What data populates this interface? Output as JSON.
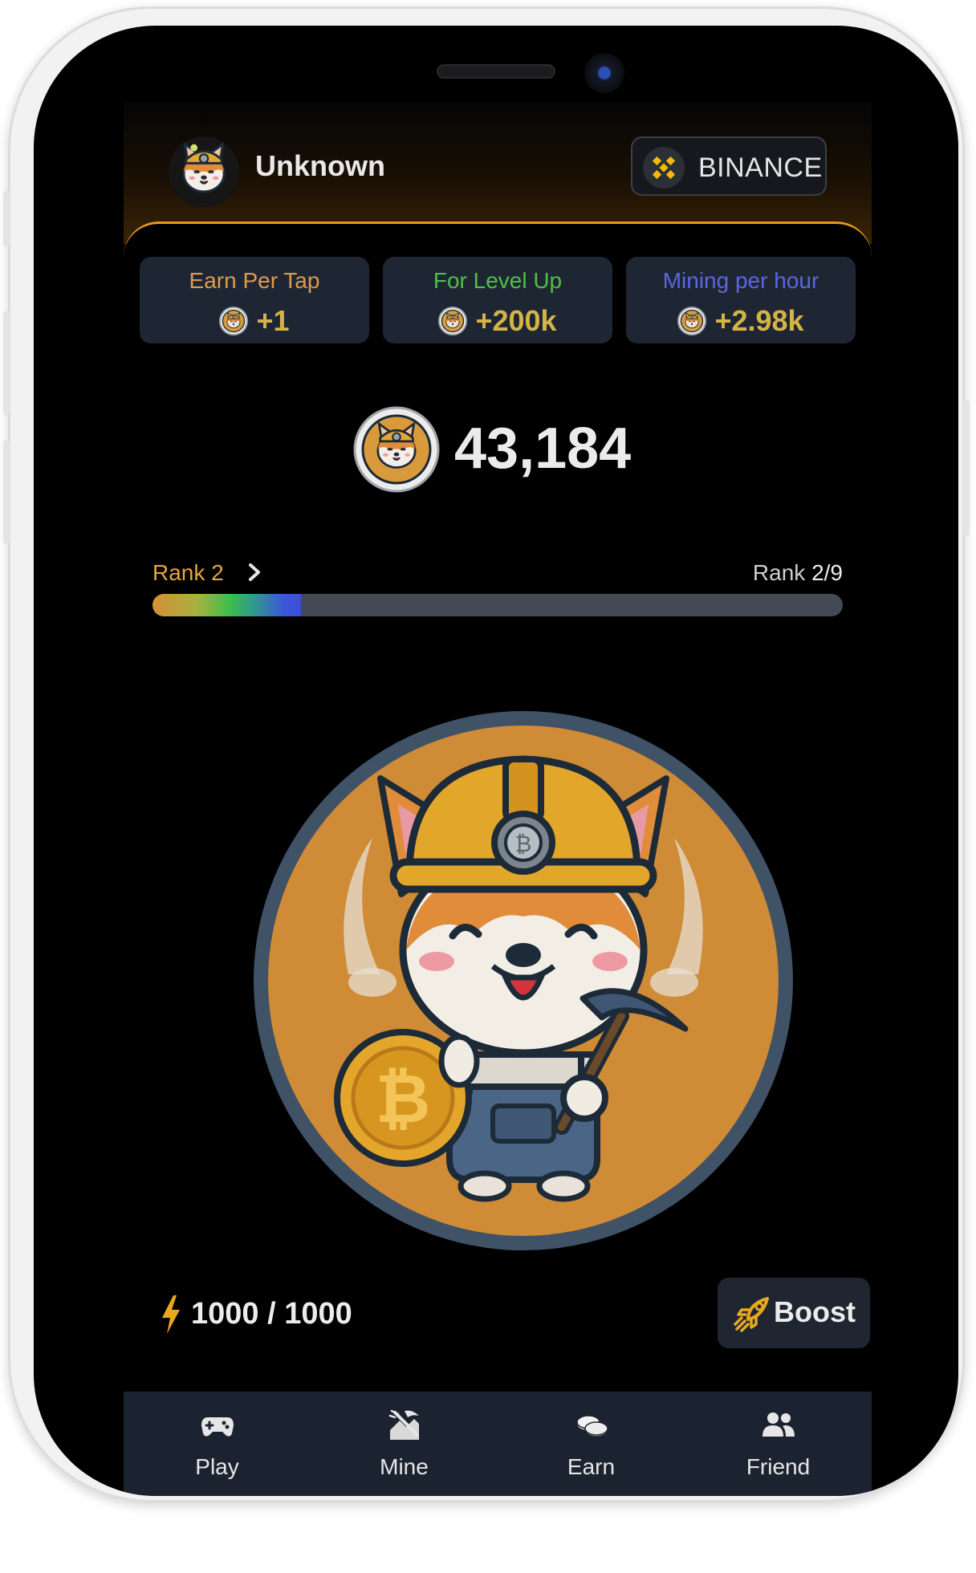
{
  "header": {
    "username": "Unknown",
    "exchange_label": "BINANCE"
  },
  "stats": [
    {
      "title": "Earn Per Tap",
      "value": "+1",
      "title_color": "#e0994a"
    },
    {
      "title": "For Level Up",
      "value": "+200k",
      "title_color": "#4fbf48"
    },
    {
      "title": "Mining per hour",
      "value": "+2.98k",
      "title_color": "#5b66e0"
    }
  ],
  "balance": "43,184",
  "rank": {
    "current_label": "Rank 2",
    "progress_label": "Rank",
    "progress_value": "2/9",
    "progress_fraction": 0.215
  },
  "energy": {
    "value": "1000 / 1000"
  },
  "boost_label": "Boost",
  "nav": [
    {
      "label": "Play",
      "icon": "gamepad-icon"
    },
    {
      "label": "Mine",
      "icon": "pickaxe-icon"
    },
    {
      "label": "Earn",
      "icon": "coins-icon"
    },
    {
      "label": "Friend",
      "icon": "friends-icon"
    }
  ],
  "colors": {
    "accent": "#e59a1f",
    "value_gold": "#d4b445",
    "card_bg": "#1e2633",
    "nav_bg": "#1c2330",
    "coin_orange": "#cf8b36"
  }
}
